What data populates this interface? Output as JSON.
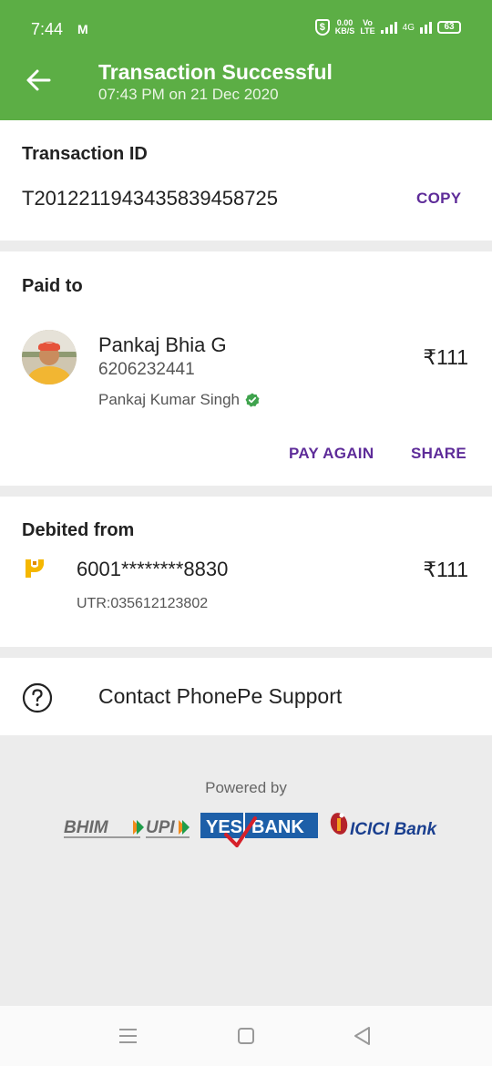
{
  "status_bar": {
    "time": "7:44",
    "mail_icon": "M",
    "speed_top": "0.00",
    "speed_bottom": "KB/S",
    "volte_top": "Vo",
    "volte_bottom": "LTE",
    "network": "4G",
    "battery": "63"
  },
  "header": {
    "title": "Transaction Successful",
    "subtitle": "07:43 PM on 21 Dec 2020",
    "bg_color": "#5cae45"
  },
  "transaction": {
    "label": "Transaction ID",
    "id": "T2012211943435839458725",
    "copy_label": "COPY"
  },
  "paid_to": {
    "label": "Paid to",
    "name": "Pankaj Bhia G",
    "phone": "6206232441",
    "registered_name": "Pankaj Kumar Singh",
    "amount": "₹111",
    "pay_again_label": "PAY AGAIN",
    "share_label": "SHARE"
  },
  "debited_from": {
    "label": "Debited from",
    "account": "6001********8830",
    "amount": "₹111",
    "utr": "UTR:035612123802"
  },
  "support": {
    "label": "Contact PhonePe Support"
  },
  "footer": {
    "powered_by": "Powered by",
    "logos": [
      "BHIM",
      "UPI",
      "YES",
      "BANK",
      "ICICI Bank"
    ]
  },
  "accent_color": "#5e2c99"
}
